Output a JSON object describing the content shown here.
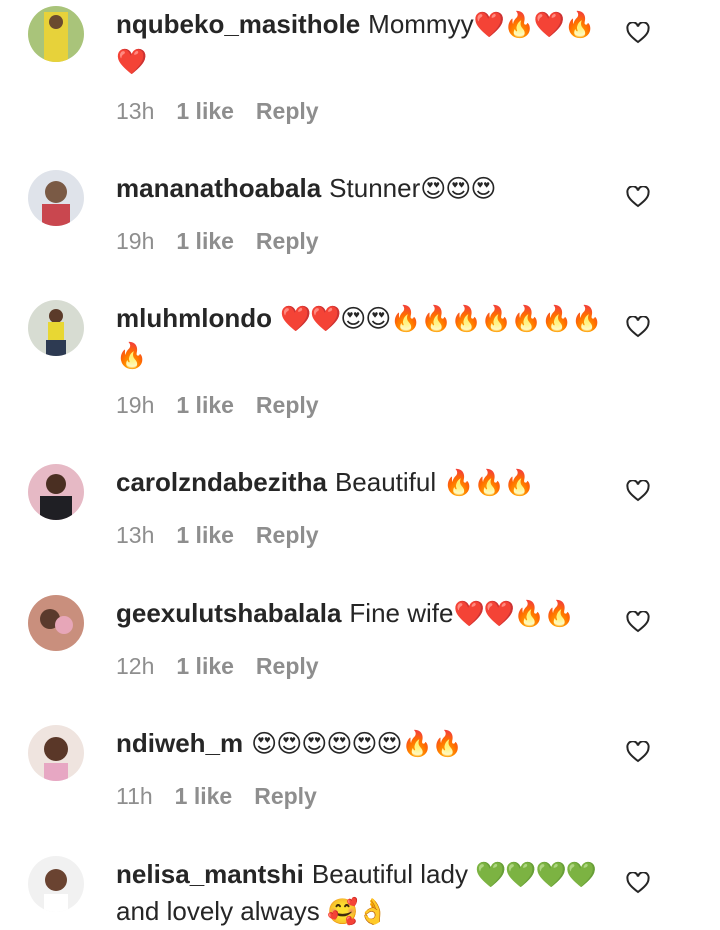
{
  "comments": [
    {
      "username": "nqubeko_masithole",
      "text": "Mommyy",
      "emoji": "❤️🔥❤️🔥❤️",
      "time": "13h",
      "likes": "1 like",
      "reply": "Reply"
    },
    {
      "username": "mananathoabala",
      "text": "Stunner",
      "emoji": "😍😍😍",
      "time": "19h",
      "likes": "1 like",
      "reply": "Reply"
    },
    {
      "username": "mluhmlondo",
      "text": "",
      "emoji": "❤️❤️😍😍🔥🔥🔥🔥🔥🔥🔥🔥",
      "time": "19h",
      "likes": "1 like",
      "reply": "Reply"
    },
    {
      "username": "carolzndabezitha",
      "text": "Beautiful ",
      "emoji": "🔥🔥🔥",
      "time": "13h",
      "likes": "1 like",
      "reply": "Reply"
    },
    {
      "username": "geexulutshabalala",
      "text": "Fine wife",
      "emoji": "❤️❤️🔥🔥",
      "time": "12h",
      "likes": "1 like",
      "reply": "Reply"
    },
    {
      "username": "ndiweh_m",
      "text": "",
      "emoji": "😍😍😍😍😍😍🔥🔥",
      "time": "11h",
      "likes": "1 like",
      "reply": "Reply"
    },
    {
      "username": "nelisa_mantshi",
      "text": "Beautiful lady ",
      "emoji": "💚💚💚💚",
      "text2": " and lovely always ",
      "emoji2": "🥰👌",
      "time": "",
      "likes": "",
      "reply": ""
    }
  ],
  "icons": {
    "like": "heart-outline-icon"
  }
}
